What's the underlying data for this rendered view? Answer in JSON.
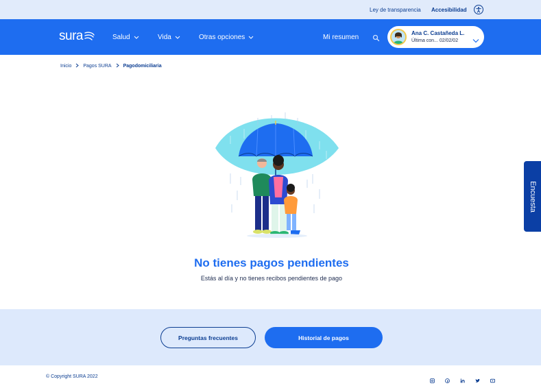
{
  "topbar": {
    "transparency_link": "Ley de transparencia",
    "accessibility_link": "Accesibilidad",
    "accessibility_icon": "accessibility-icon"
  },
  "navbar": {
    "logo_text": "sura",
    "items": [
      {
        "label": "Salud",
        "icon": "chevron-down-icon"
      },
      {
        "label": "Vida",
        "icon": "chevron-down-icon"
      },
      {
        "label": "Otras opciones",
        "icon": "chevron-down-icon"
      }
    ],
    "summary_label": "Mi resumen",
    "search_icon": "search-icon",
    "user": {
      "name": "Ana C. Castañeda L.",
      "last_access": "Última con... 02/02/02",
      "menu_icon": "chevron-down-icon"
    }
  },
  "breadcrumb": {
    "items": [
      "Inicio",
      "Pagos SURA",
      "Pagodomiciliaria"
    ]
  },
  "main": {
    "illustration": "family-under-umbrella-illustration",
    "title": "No tienes pagos pendientes",
    "subtitle": "Estás al día y no tienes recibos pendientes de pago"
  },
  "survey_tab": {
    "label": "Encuesta"
  },
  "actions": {
    "faq_label": "Preguntas frecuentes",
    "history_label": "Historial de pagos"
  },
  "footer": {
    "copyright": "© Copyright SURA 2022",
    "social_icons": [
      "instagram-icon",
      "facebook-icon",
      "linkedin-icon",
      "twitter-icon",
      "youtube-icon"
    ]
  },
  "colors": {
    "primary": "#1e6df0",
    "dark_blue": "#0b3d91",
    "topbar_bg": "#e1ebfb",
    "actions_bg": "#dde9fc",
    "survey_bg": "#0b3fa5"
  }
}
